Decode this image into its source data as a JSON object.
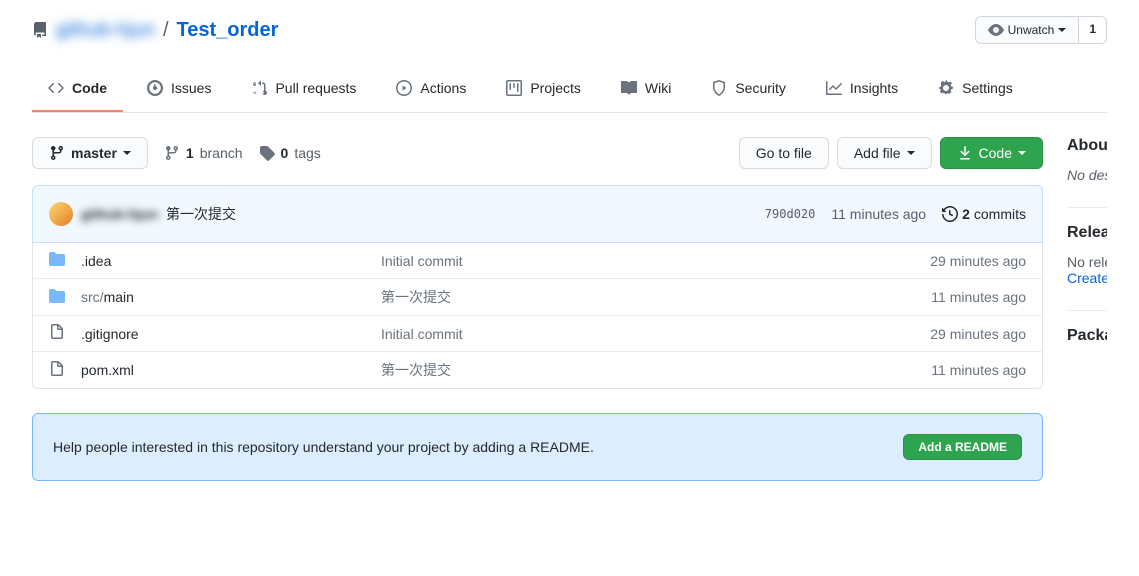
{
  "repo": {
    "owner": "github-hjun",
    "name": "Test_order"
  },
  "watch": {
    "label": "Unwatch",
    "count": "1"
  },
  "tabs": [
    {
      "label": "Code",
      "active": true
    },
    {
      "label": "Issues"
    },
    {
      "label": "Pull requests"
    },
    {
      "label": "Actions"
    },
    {
      "label": "Projects"
    },
    {
      "label": "Wiki"
    },
    {
      "label": "Security"
    },
    {
      "label": "Insights"
    },
    {
      "label": "Settings"
    }
  ],
  "branch": {
    "current": "master",
    "branch_count": "1",
    "branch_label": "branch",
    "tag_count": "0",
    "tag_label": "tags"
  },
  "file_actions": {
    "go_to_file": "Go to file",
    "add_file": "Add file",
    "code": "Code"
  },
  "latest_commit": {
    "author": "github-hjun",
    "message": "第一次提交",
    "sha": "790d020",
    "time": "11 minutes ago",
    "commit_count": "2",
    "commit_label": "commits"
  },
  "files": [
    {
      "type": "folder",
      "name": ".idea",
      "msg": "Initial commit",
      "time": "29 minutes ago"
    },
    {
      "type": "folder",
      "name": "src/main",
      "msg": "第一次提交",
      "time": "11 minutes ago"
    },
    {
      "type": "file",
      "name": ".gitignore",
      "msg": "Initial commit",
      "time": "29 minutes ago"
    },
    {
      "type": "file",
      "name": "pom.xml",
      "msg": "第一次提交",
      "time": "11 minutes ago"
    }
  ],
  "readme_prompt": {
    "text": "Help people interested in this repository understand your project by adding a README.",
    "button": "Add a README"
  },
  "sidebar": {
    "about": {
      "title": "About",
      "text": "No description, website, or topics provided."
    },
    "releases": {
      "title": "Releases",
      "empty": "No releases published",
      "create": "Create a new release"
    },
    "packages": {
      "title": "Packages"
    }
  }
}
